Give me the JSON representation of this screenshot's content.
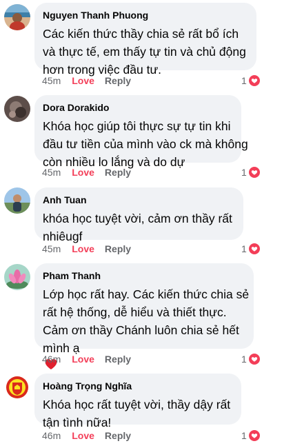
{
  "comments": [
    {
      "author": "Nguyen Thanh Phuong",
      "lines": [
        "Các kiến thức thầy chia sẻ rất bổ ích",
        "và thực tế, em thấy tự tin và chủ động",
        "hơn trong việc đầu tư."
      ],
      "time": "45m",
      "love_label": "Love",
      "reply_label": "Reply",
      "reaction_count": "1",
      "avatar_icon": "beach-photo-avatar"
    },
    {
      "author": "Dora Dorakido",
      "lines": [
        "Khóa học giúp tôi thực sự tự tin khi",
        "đầu tư tiền của mình vào ck mà không",
        "còn nhiều lo lắng và do dự"
      ],
      "time": "45m",
      "love_label": "Love",
      "reply_label": "Reply",
      "reaction_count": "1",
      "avatar_icon": "dark-photo-avatar"
    },
    {
      "author": "Anh Tuan",
      "lines": [
        "khóa học tuyệt vời, cảm ơn thầy rất",
        "nhiêugf"
      ],
      "time": "45m",
      "love_label": "Love",
      "reply_label": "Reply",
      "reaction_count": "1",
      "avatar_icon": "outdoor-photo-avatar"
    },
    {
      "author": "Pham Thanh",
      "lines": [
        "Lớp học rất hay. Các kiến thức chia sẻ",
        "rất hệ thống, dễ hiểu và thiết thực.",
        "Cảm ơn thầy Chánh luôn chia sẻ hết",
        "mình ạ"
      ],
      "time": "46m",
      "love_label": "Love",
      "reply_label": "Reply",
      "reaction_count": "1",
      "avatar_icon": "lotus-flower-avatar"
    },
    {
      "author": "Hoàng Trọng Nghĩa",
      "lines": [
        "Khóa học rất tuyệt vời, thầy dậy rất",
        "tận tình nữa!"
      ],
      "time": "46m",
      "love_label": "Love",
      "reply_label": "Reply",
      "reaction_count": "1",
      "avatar_icon": "football-crest-avatar"
    }
  ],
  "colors": {
    "bubble": "#f0f2f5",
    "love": "#f33e58",
    "meta": "#65676b",
    "text": "#050505"
  }
}
